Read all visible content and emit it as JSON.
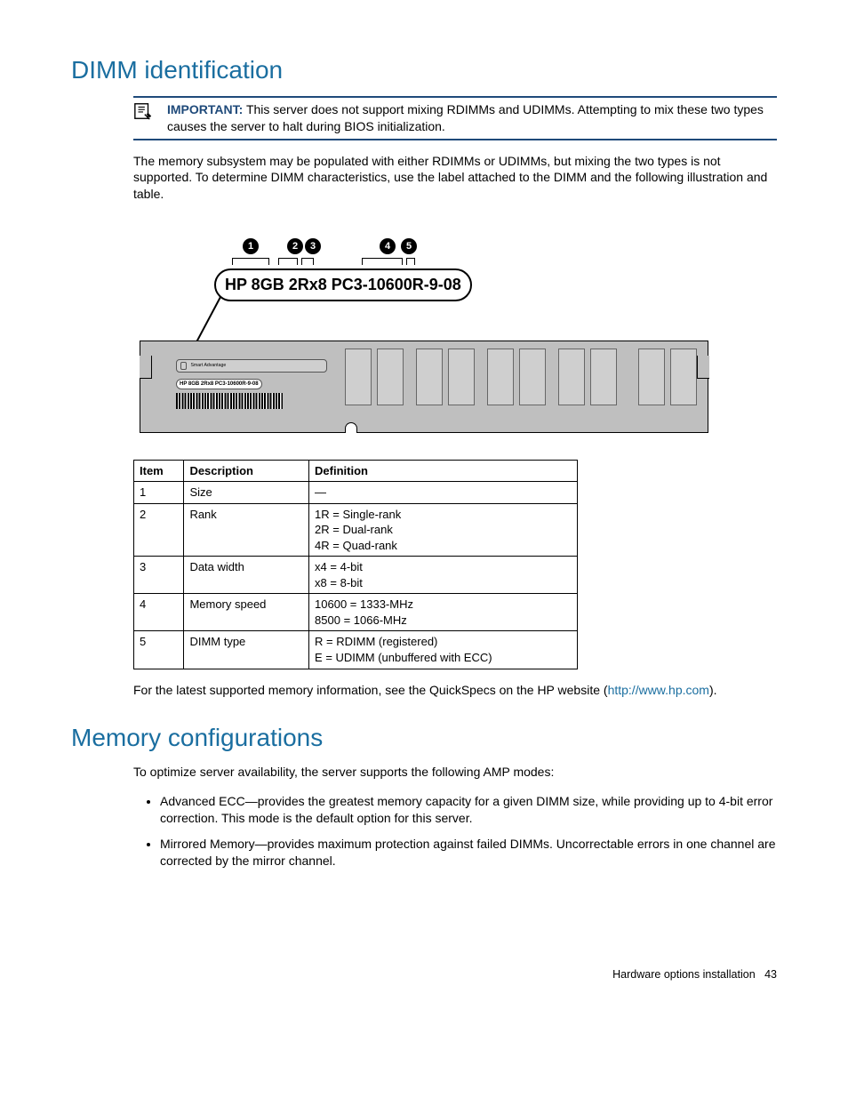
{
  "section1": {
    "title": "DIMM identification",
    "important_label": "IMPORTANT:",
    "important_text": "This server does not support mixing RDIMMs and UDIMMs. Attempting to mix these two types causes the server to halt during BIOS initialization.",
    "intro": "The memory subsystem may be populated with either RDIMMs or UDIMMs, but mixing the two types is not supported. To determine DIMM characteristics, use the label attached to the DIMM and the following illustration and table."
  },
  "figure": {
    "callouts": [
      "1",
      "2",
      "3",
      "4",
      "5"
    ],
    "bubble": "HP 8GB 2Rx8 PC3-10600R-9-08",
    "tiny_label": "HP 8GB 2Rx8 PC3-10600R-9-08"
  },
  "table": {
    "headers": [
      "Item",
      "Description",
      "Definition"
    ],
    "rows": [
      {
        "item": "1",
        "desc": "Size",
        "def": "—"
      },
      {
        "item": "2",
        "desc": "Rank",
        "def": "1R = Single-rank\n2R = Dual-rank\n4R = Quad-rank"
      },
      {
        "item": "3",
        "desc": "Data width",
        "def": "x4 = 4-bit\nx8 = 8-bit"
      },
      {
        "item": "4",
        "desc": "Memory speed",
        "def": "10600 = 1333-MHz\n8500 = 1066-MHz"
      },
      {
        "item": "5",
        "desc": "DIMM type",
        "def": "R = RDIMM (registered)\nE = UDIMM (unbuffered with ECC)"
      }
    ]
  },
  "footnote": {
    "pre": "For the latest supported memory information, see the QuickSpecs on the HP website (",
    "link_text": "http://www.hp.com",
    "post": ")."
  },
  "section2": {
    "title": "Memory configurations",
    "intro": "To optimize server availability, the server supports the following AMP modes:",
    "bullets": [
      "Advanced ECC—provides the greatest memory capacity for a given DIMM size, while providing up to 4-bit error correction.  This mode is the default option for this server.",
      "Mirrored Memory—provides maximum protection against failed DIMMs. Uncorrectable errors in one channel are corrected by the mirror channel."
    ]
  },
  "footer": {
    "chapter": "Hardware options installation",
    "page": "43"
  }
}
